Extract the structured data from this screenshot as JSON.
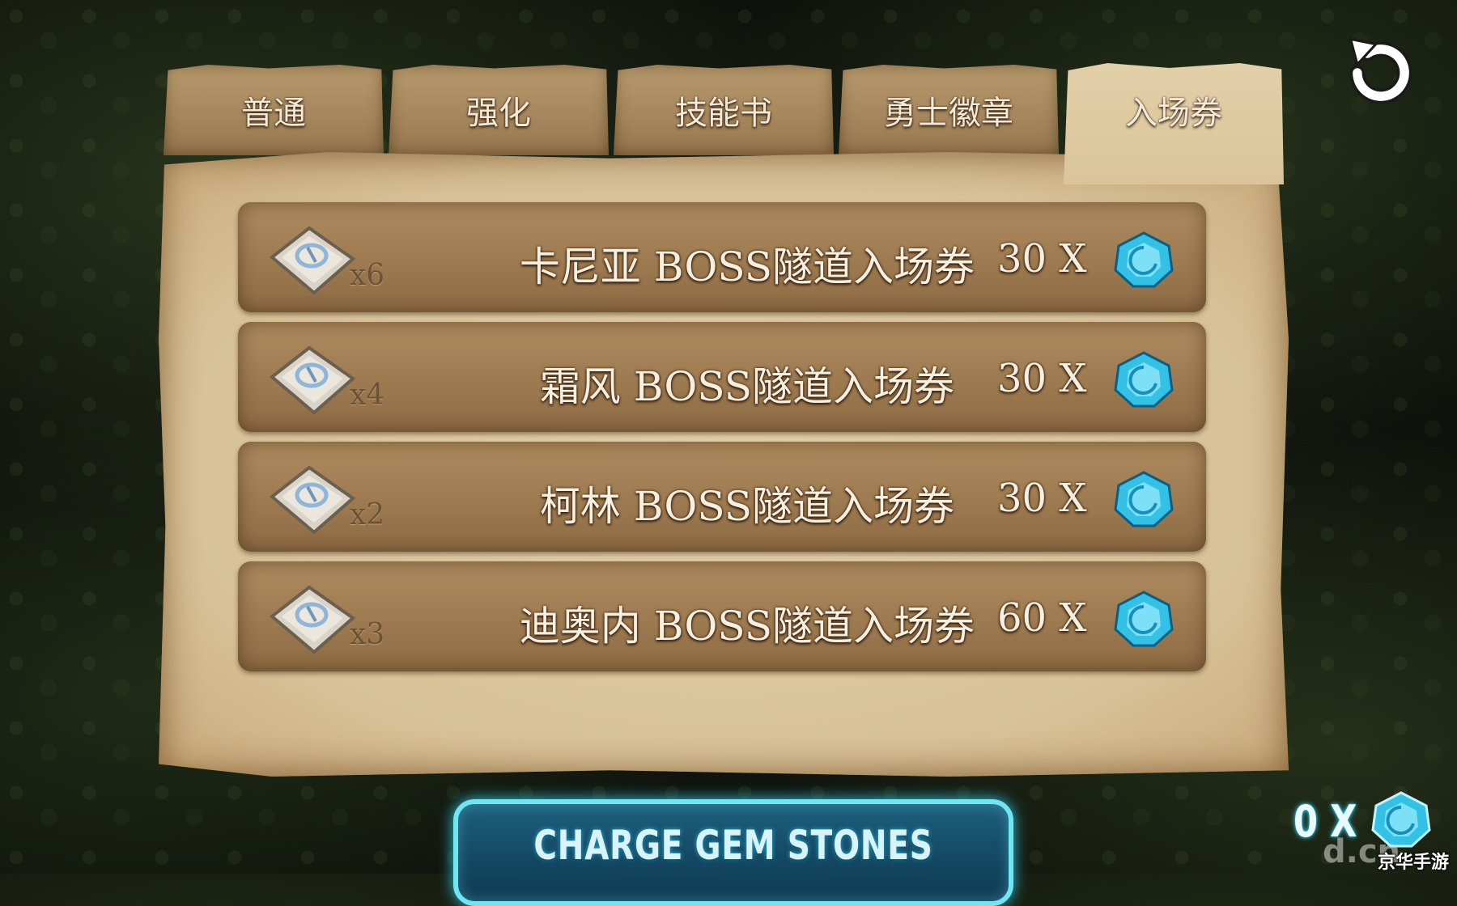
{
  "tabs": [
    {
      "label": "普通",
      "active": false
    },
    {
      "label": "强化",
      "active": false
    },
    {
      "label": "技能书",
      "active": false
    },
    {
      "label": "勇士徽章",
      "active": false
    },
    {
      "label": "入场券",
      "active": true
    }
  ],
  "items": [
    {
      "icon": "ticket-icon",
      "quantity": "x6",
      "name": "卡尼亚 BOSS隧道入场券",
      "price": "30 X",
      "currency_icon": "gem-icon"
    },
    {
      "icon": "ticket-icon",
      "quantity": "x4",
      "name": "霜风 BOSS隧道入场券",
      "price": "30 X",
      "currency_icon": "gem-icon"
    },
    {
      "icon": "ticket-icon",
      "quantity": "x2",
      "name": "柯林 BOSS隧道入场券",
      "price": "30 X",
      "currency_icon": "gem-icon"
    },
    {
      "icon": "ticket-icon",
      "quantity": "x3",
      "name": "迪奥内 BOSS隧道入场券",
      "price": "60 X",
      "currency_icon": "gem-icon"
    }
  ],
  "charge_button": {
    "label": "CHARGE GEM STONES"
  },
  "balance": {
    "text": "0 X",
    "icon": "gem-icon"
  },
  "refresh_icon": "refresh-icon",
  "watermark": {
    "logo": "d.cn",
    "text": "京华手游"
  },
  "colors": {
    "parchment": "#dcc79f",
    "row": "#9d7a50",
    "gem": "#3ec3e6",
    "button_border": "#6fe6f2"
  }
}
